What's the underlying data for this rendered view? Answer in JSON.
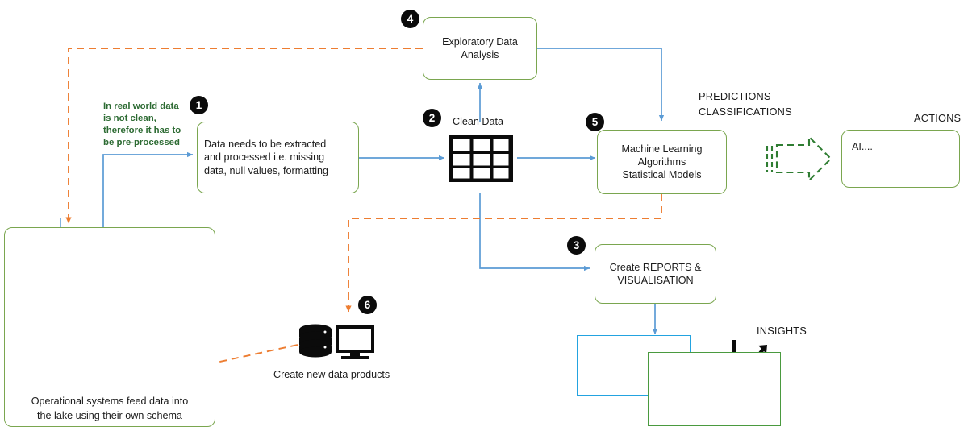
{
  "diagram": {
    "title": "Data lake to AI pipeline flow diagram",
    "colors": {
      "box_border_green": "#7aa64f",
      "arrow_blue": "#5b9bd5",
      "arrow_orange": "#ed7d31",
      "arrow_green": "#2f7d32",
      "note_green": "#2d6b33",
      "card_blue": "#23a3e0",
      "card_green": "#4a9a3f",
      "lake_fill": "#d6e4f2",
      "badge_bg": "#0b0b0b"
    }
  },
  "notes": {
    "preprocess": "In real world data\nis not clean,\ntherefore it has to\nbe pre-processed"
  },
  "badges": {
    "one": "1",
    "two": "2",
    "three": "3",
    "four": "4",
    "five": "5",
    "six": "6"
  },
  "boxes": {
    "eda": "Exploratory Data\nAnalysis",
    "extract": "Data needs to be extracted\nand processed i.e. missing\ndata, null values, formatting",
    "ml": "Machine Learning\nAlgorithms\nStatistical Models",
    "reports": "Create REPORTS &\nVISUALISATION",
    "ai": "AI....",
    "lake_caption": "Operational systems feed data into\nthe lake using their own schema"
  },
  "labels": {
    "clean_data": "Clean Data",
    "predictions": "PREDICTIONS",
    "classifications": "CLASSIFICATIONS",
    "actions": "ACTIONS",
    "insights": "INSIGHTS",
    "data_products": "Create new data products"
  },
  "icons": {
    "clean_data_table": "table-grid-icon",
    "data_products": "database-monitor-icon",
    "lake": "data-lake-icon",
    "database": "database-cylinder-icon",
    "bar_chart": "bar-chart-icon",
    "gauge": "gauge-icon",
    "trend_up": "trend-up-line-chart-icon",
    "trend_down": "trend-down-line-chart-icon"
  }
}
